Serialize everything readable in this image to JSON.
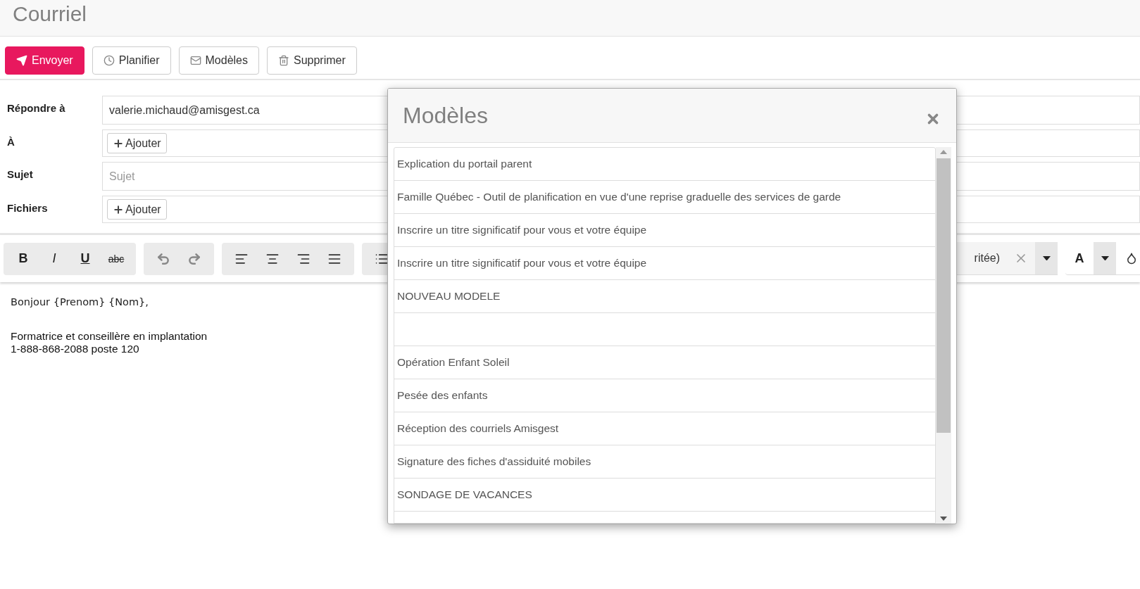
{
  "page": {
    "title": "Courriel"
  },
  "actions": [
    {
      "label": "Envoyer",
      "kind": "send"
    },
    {
      "label": "Planifier",
      "kind": "schedule"
    },
    {
      "label": "Modèles",
      "kind": "templates"
    },
    {
      "label": "Supprimer",
      "kind": "delete"
    }
  ],
  "fields": [
    {
      "label": "Répondre à",
      "kind": "text",
      "value": "valerie.michaud@amisgest.ca"
    },
    {
      "label": "À",
      "kind": "add",
      "button": "Ajouter"
    },
    {
      "label": "Sujet",
      "kind": "text",
      "placeholder": "Sujet"
    },
    {
      "label": "Fichiers",
      "kind": "add",
      "button": "Ajouter"
    }
  ],
  "editor_toolbar": {
    "format_buttons": [
      {
        "label": "B",
        "kind": "bold"
      },
      {
        "label": "I",
        "kind": "italic"
      },
      {
        "label": "U",
        "kind": "underline"
      },
      {
        "label": "abc",
        "kind": "strike"
      }
    ],
    "font_select": {
      "value": "ritée)"
    },
    "color_button": {
      "label": "A"
    }
  },
  "body": {
    "greeting": "Bonjour {Prenom} {Nom},",
    "signature": [
      "Formatrice et conseillère en implantation",
      "1-888-868-2088 poste 120"
    ]
  },
  "modal": {
    "title": "Modèles",
    "items": [
      {
        "kind": "template",
        "label": "Explication du portail parent"
      },
      {
        "kind": "template",
        "label": "Famille Québec - Outil de planification en vue d'une reprise graduelle des services de garde"
      },
      {
        "kind": "template",
        "label": "Inscrire un titre significatif pour vous et votre équipe"
      },
      {
        "kind": "template",
        "label": "Inscrire un titre significatif pour vous et votre équipe"
      },
      {
        "kind": "template",
        "label": "NOUVEAU MODELE"
      },
      {
        "kind": "blank"
      },
      {
        "kind": "template",
        "label": "Opération Enfant Soleil"
      },
      {
        "kind": "template",
        "label": "Pesée des enfants"
      },
      {
        "kind": "template",
        "label": "Réception des courriels Amisgest"
      },
      {
        "kind": "template",
        "label": "Signature des fiches d'assiduité mobiles"
      },
      {
        "kind": "template",
        "label": "SONDAGE DE VACANCES"
      }
    ]
  }
}
